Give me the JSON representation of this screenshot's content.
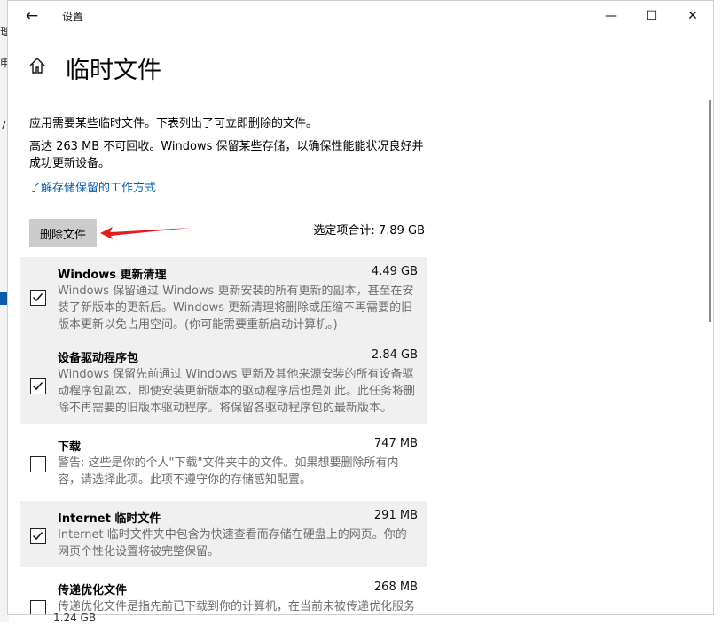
{
  "background_app": {
    "fragments": [
      "理",
      "申",
      "7"
    ]
  },
  "window": {
    "title": "设置",
    "controls": {
      "minimize": "—",
      "maximize": "☐",
      "close": "✕"
    }
  },
  "page": {
    "title": "临时文件",
    "description": "应用需要某些临时文件。下表列出了可立即删除的文件。",
    "reserved_note": "高达 263 MB 不可回收。Windows 保留某些存储，以确保性能能状况良好并成功更新设备。",
    "learn_link": "了解存储保留的工作方式",
    "delete_button": "删除文件",
    "selected_total": "选定项合计: 7.89 GB"
  },
  "items": [
    {
      "name": "Windows 更新清理",
      "size": "4.49 GB",
      "checked": true,
      "description": "Windows 保留通过 Windows 更新安装的所有更新的副本，甚至在安装了新版本的更新后。Windows 更新清理将删除或压缩不再需要的旧版本更新以免占用空间。(你可能需要重新启动计算机。)"
    },
    {
      "name": "设备驱动程序包",
      "size": "2.84 GB",
      "checked": true,
      "description": "Windows 保留先前通过 Windows 更新及其他来源安装的所有设备驱动程序包副本，即使安装更新版本的驱动程序后也是如此。此任务将删除不再需要的旧版本驱动程序。将保留各驱动程序包的最新版本。"
    },
    {
      "name": "下载",
      "size": "747 MB",
      "checked": false,
      "description": "警告: 这些是你的个人\"下载\"文件夹中的文件。如果想要删除所有内容，请选择此项。此项不遵守你的存储感知配置。"
    },
    {
      "name": "Internet 临时文件",
      "size": "291 MB",
      "checked": true,
      "description": "Internet 临时文件夹中包含为快速查看而存储在硬盘上的网页。你的网页个性化设置将被完整保留。"
    },
    {
      "name": "传递优化文件",
      "size": "268 MB",
      "checked": false,
      "description": "传递优化文件是指先前已下载到你的计算机，在当前未被传递优化服务使用的文件。"
    }
  ],
  "bottom_peek": "1.24 GB"
}
